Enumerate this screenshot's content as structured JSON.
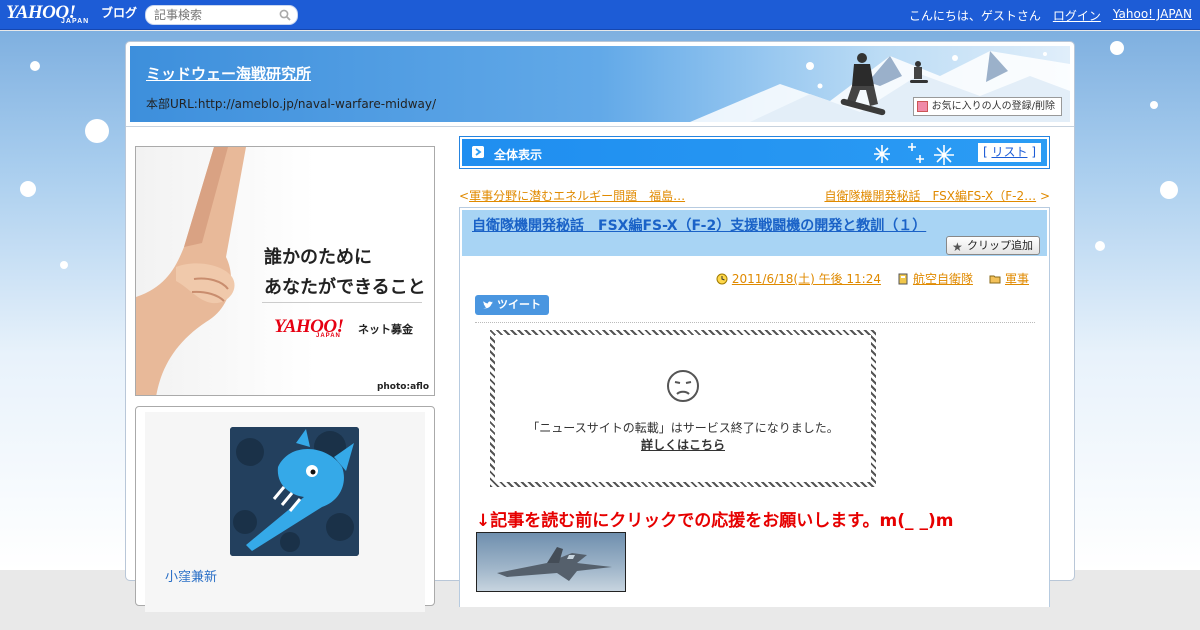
{
  "topbar": {
    "logo": "YAHOO!",
    "logo_sub": "JAPAN",
    "logo_blog": "ブログ",
    "search_placeholder": "記事検索",
    "greeting": "こんにちは、ゲストさん",
    "login": "ログイン",
    "yahoo_japan": "Yahoo! JAPAN"
  },
  "header": {
    "blog_title": "ミッドウェー海戦研究所",
    "blog_url": "本部URL:http://ameblo.jp/naval-warfare-midway/",
    "favorite_button": "お気に入りの人の登録/削除"
  },
  "sidebar": {
    "banner": {
      "line1": "誰かのために",
      "line2": "あなたができること",
      "brand": "YAHOO!",
      "brand_sub": "JAPAN",
      "service": "ネット募金",
      "credit": "photo:aflo"
    },
    "profile": {
      "name": "小窪兼新"
    }
  },
  "main": {
    "bar": {
      "title": "全体表示",
      "list_open": "[",
      "list_link": "リスト",
      "list_close": "]"
    },
    "prev": {
      "arrow": "<",
      "label": "軍事分野に潜むエネルギー問題　福島…"
    },
    "next": {
      "label": "自衛隊機開発秘話　FSX編FS-X（F-2…",
      "arrow": ">"
    },
    "article": {
      "title": "自衛隊機開発秘話　FSX編FS-X（F-2）支援戦闘機の開発と教訓（１）",
      "clip_button": "クリップ追加",
      "date": "2011/6/18(土) 午後 11:24",
      "category1": "航空自衛隊",
      "category2": "軍事",
      "tweet": "ツイート",
      "notice_text": "「ニュースサイトの転載」はサービス終了になりました。",
      "notice_link": "詳しくはこちら",
      "red_message": "↓記事を読む前にクリックでの応援をお願いします。m(_ _)m"
    }
  },
  "colors": {
    "topbar": "#1d5cd6",
    "accent_blue": "#2b9cf4",
    "link_orange": "#e08a00",
    "title_blue": "#1a62c7",
    "red_message": "#e60000"
  }
}
